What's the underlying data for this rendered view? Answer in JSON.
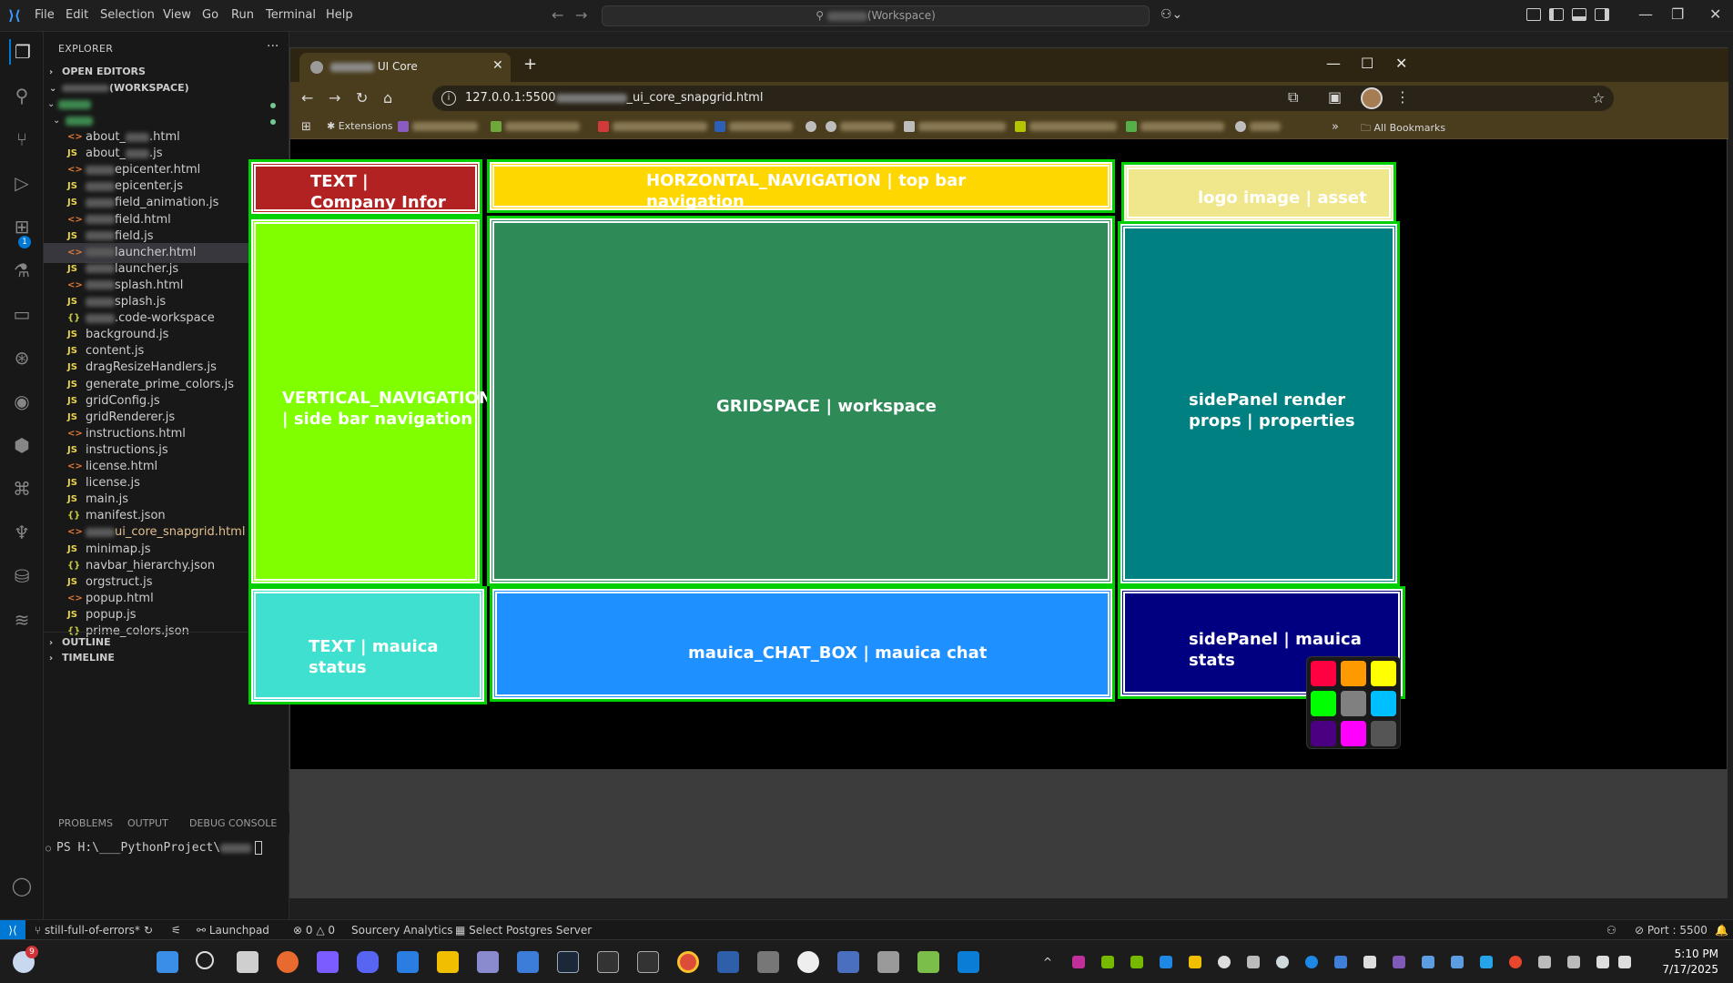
{
  "menu": [
    "File",
    "Edit",
    "Selection",
    "View",
    "Go",
    "Run",
    "Terminal",
    "Help"
  ],
  "command_center": "(Workspace)",
  "explorer": {
    "title": "EXPLORER",
    "open_editors": "OPEN EDITORS",
    "workspace": "(WORKSPACE)",
    "files": [
      {
        "name": "about_",
        "suffix": ".html",
        "type": "html"
      },
      {
        "name": "about_",
        "suffix": ".js",
        "type": "js"
      },
      {
        "name": "",
        "suffix": "epicenter.html",
        "type": "html"
      },
      {
        "name": "",
        "suffix": "epicenter.js",
        "type": "js"
      },
      {
        "name": "",
        "suffix": "field_animation.js",
        "type": "js"
      },
      {
        "name": "",
        "suffix": "field.html",
        "type": "html"
      },
      {
        "name": "",
        "suffix": "field.js",
        "type": "js"
      },
      {
        "name": "",
        "suffix": "launcher.html",
        "type": "html"
      },
      {
        "name": "",
        "suffix": "launcher.js",
        "type": "js"
      },
      {
        "name": "",
        "suffix": "splash.html",
        "type": "html"
      },
      {
        "name": "",
        "suffix": "splash.js",
        "type": "js"
      },
      {
        "name": "",
        "suffix": ".code-workspace",
        "type": "json"
      },
      {
        "name": "background.js",
        "suffix": "",
        "type": "js"
      },
      {
        "name": "content.js",
        "suffix": "",
        "type": "js"
      },
      {
        "name": "dragResizeHandlers.js",
        "suffix": "",
        "type": "js"
      },
      {
        "name": "generate_prime_colors.js",
        "suffix": "",
        "type": "js"
      },
      {
        "name": "gridConfig.js",
        "suffix": "",
        "type": "js"
      },
      {
        "name": "gridRenderer.js",
        "suffix": "",
        "type": "js"
      },
      {
        "name": "instructions.html",
        "suffix": "",
        "type": "html"
      },
      {
        "name": "instructions.js",
        "suffix": "",
        "type": "js"
      },
      {
        "name": "license.html",
        "suffix": "",
        "type": "html"
      },
      {
        "name": "license.js",
        "suffix": "",
        "type": "js"
      },
      {
        "name": "main.js",
        "suffix": "",
        "type": "js"
      },
      {
        "name": "manifest.json",
        "suffix": "",
        "type": "json"
      },
      {
        "name": "",
        "suffix": "ui_core_snapgrid.html",
        "type": "html",
        "git": "M"
      },
      {
        "name": "minimap.js",
        "suffix": "",
        "type": "js"
      },
      {
        "name": "navbar_hierarchy.json",
        "suffix": "",
        "type": "json"
      },
      {
        "name": "orgstruct.js",
        "suffix": "",
        "type": "js"
      },
      {
        "name": "popup.html",
        "suffix": "",
        "type": "html"
      },
      {
        "name": "popup.js",
        "suffix": "",
        "type": "js"
      },
      {
        "name": "prime_colors.json",
        "suffix": "",
        "type": "json"
      }
    ],
    "outline": "OUTLINE",
    "timeline": "TIMELINE"
  },
  "panel_tabs": [
    "PROBLEMS",
    "OUTPUT",
    "DEBUG CONSOLE"
  ],
  "terminal": "PS H:\\___PythonProject\\",
  "browser": {
    "tab_title": "UI Core",
    "url_prefix": "127.0.0.1:5500",
    "url_suffix": "_ui_core_snapgrid.html",
    "bookmarks": [
      "Extensions"
    ],
    "all_bookmarks": "All Bookmarks"
  },
  "panels": {
    "company": "TEXT |\nCompany Infor",
    "topnav": "HORZONTAL_NAVIGATION | top bar\nnavigation",
    "logo": "logo image | asset",
    "sidenav": "VERTICAL_NAVIGATION\n| side bar navigation",
    "grid": "GRIDSPACE | workspace",
    "props": "sidePanel render\nprops | properties",
    "status": "TEXT | mauica\nstatus",
    "chat": "mauica_CHAT_BOX | mauica chat",
    "stats": "sidePanel | mauica\nstats"
  },
  "colors": {
    "company": "#b22222",
    "topnav": "#ffd700",
    "logo": "#f0e68c",
    "sidenav": "#7fff00",
    "grid": "#2e8b57",
    "props": "#008080",
    "status": "#40e0d0",
    "chat": "#1e90ff",
    "stats": "#000080",
    "palette": [
      "#ff0040",
      "#ff9900",
      "#ffff00",
      "#00ff00",
      "#808080",
      "#00bfff",
      "#4b0082",
      "#ff00ff",
      "#555555"
    ]
  },
  "statusbar": {
    "branch": "still-full-of-errors*",
    "launchpad": "Launchpad",
    "problems": "0",
    "warnings": "0",
    "sourcery": "Sourcery Analytics",
    "postgres": "Select Postgres Server",
    "port": "Port : 5500"
  },
  "taskbar": {
    "badge": "9",
    "time": "5:10 PM",
    "date": "7/17/2025"
  }
}
